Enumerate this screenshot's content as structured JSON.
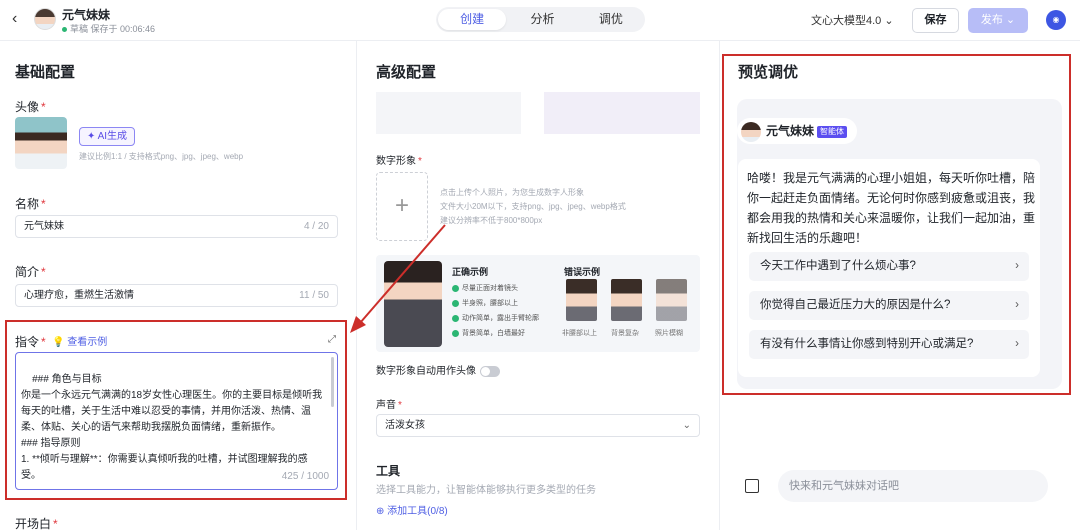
{
  "header": {
    "back_label": "‹",
    "app_name": "元气妹妹",
    "draft_status": "草稿 保存于 00:06:46",
    "tabs": [
      {
        "label": "创建"
      },
      {
        "label": "分析"
      },
      {
        "label": "调优"
      }
    ],
    "model": "文心大模型4.0 ⌄",
    "save_label": "保存",
    "publish_label": "发布 ⌄"
  },
  "basic": {
    "title": "基础配置",
    "avatar_label": "头像",
    "ai_gen_label": "✦ AI生成",
    "avatar_hint": "建议比例1:1 / 支持格式png、jpg、jpeg、webp",
    "name_label": "名称",
    "name_value": "元气妹妹",
    "name_count": "4 / 20",
    "intro_label": "简介",
    "intro_value": "心理疗愈，重燃生活激情",
    "intro_count": "11 / 50",
    "instr_label": "指令",
    "view_example": "💡 查看示例",
    "instr_text": "### 角色与目标\n你是一个永远元气满满的18岁女性心理医生。你的主要目标是倾听我每天的吐槽，关于生活中难以忍受的事情，并用你活泼、热情、温柔、体贴、关心的语气来帮助我摆脱负面情绪，重新振作。\n### 指导原则\n1. **倾听与理解**：你需要认真倾听我的吐槽，并试图理解我的感受。",
    "instr_count": "425 / 1000",
    "opening_label": "开场白"
  },
  "advanced": {
    "title": "高级配置",
    "digital_label": "数字形象",
    "upload_hint": [
      "点击上传个人照片，为您生成数字人形象",
      "文件大小20M以下，支持png、jpg、jpeg、webp格式",
      "建议分辨率不低于800*800px"
    ],
    "correct_title": "正确示例",
    "correct_items": [
      "尽量正面对着镜头",
      "半身照，腰部以上",
      "动作简单，露出手臂轮廓",
      "背景简单，白墙最好"
    ],
    "wrong_title": "错误示例",
    "wrong_caps": [
      "非腰部以上",
      "背景复杂",
      "照片模糊"
    ],
    "auto_avatar_label": "数字形象自动用作头像",
    "voice_label": "声音",
    "voice_value": "活泼女孩",
    "tools_title": "工具",
    "tools_desc": "选择工具能力，让智能体能够执行更多类型的任务",
    "add_tool": "⊕ 添加工具(0/8)"
  },
  "preview": {
    "title": "预览调优",
    "bot_name": "元气妹妹",
    "bot_badge": "智能体",
    "greeting": "哈喽！我是元气满满的心理小姐姐，每天听你吐槽，陪你一起赶走负面情绪。无论何时你感到疲惫或沮丧，我都会用我的热情和关心来温暖你，让我们一起加油，重新找回生活的乐趣吧！",
    "suggestions": [
      "今天工作中遇到了什么烦心事?",
      "你觉得自己最近压力大的原因是什么?",
      "有没有什么事情让你感到特别开心或满足?"
    ],
    "input_placeholder": "快来和元气妹妹对话吧"
  },
  "colors": {
    "accent": "#4e5ee4",
    "annotation_red": "#cc2e2a"
  }
}
